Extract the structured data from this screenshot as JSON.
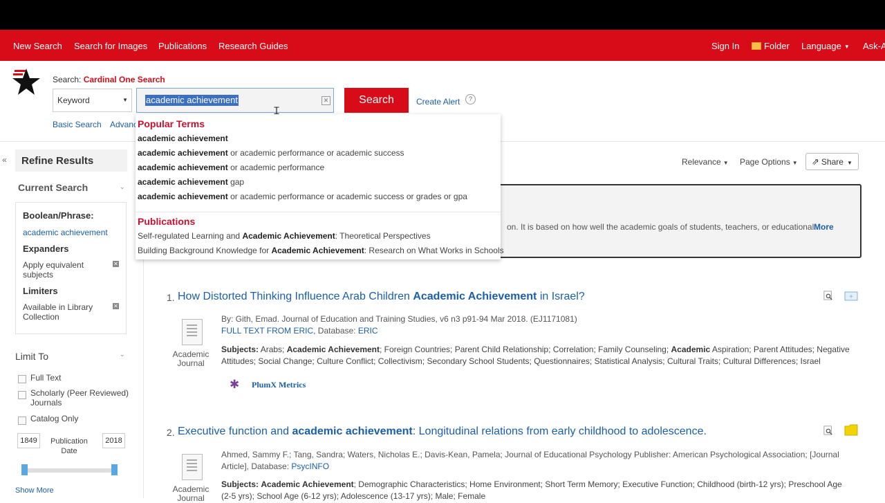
{
  "nav": {
    "new_search": "New Search",
    "search_images": "Search for Images",
    "publications": "Publications",
    "research_guides": "Research Guides",
    "sign_in": "Sign In",
    "folder": "Folder",
    "language": "Language",
    "ask": "Ask-A"
  },
  "search": {
    "label_prefix": "Search:",
    "label_db": "Cardinal One Search",
    "field_type": "Keyword",
    "query": "academic achievement",
    "button": "Search",
    "create_alert": "Create Alert",
    "help": "?",
    "basic": "Basic Search",
    "advanced": "Advanced Search"
  },
  "autocomplete": {
    "popular_heading": "Popular Terms",
    "terms": [
      {
        "bold": "academic achievement",
        "rest": ""
      },
      {
        "bold": "academic achievement",
        "rest": " or academic performance or academic success"
      },
      {
        "bold": "academic achievement",
        "rest": " or academic performance"
      },
      {
        "bold": "academic achievement",
        "rest": " gap"
      },
      {
        "bold": "academic achievement",
        "rest": " or academic performance or academic success or grades or gpa"
      }
    ],
    "publications_heading": "Publications",
    "publications": [
      {
        "pre": "Self-regulated Learning and ",
        "bold": "Academic Achievement",
        "post": ": Theoretical Perspectives"
      },
      {
        "pre": "Building Background Knowledge for ",
        "bold": "Academic Achievement",
        "post": ": Research on What Works in Schools"
      }
    ]
  },
  "sidebar": {
    "refine_title": "Refine Results",
    "current_search": "Current Search",
    "boolean_label": "Boolean/Phrase:",
    "boolean_value": "academic achievement",
    "expanders": "Expanders",
    "expander_item": "Apply equivalent subjects",
    "limiters": "Limiters",
    "limiter_item": "Available in Library Collection",
    "limit_to": "Limit To",
    "full_text": "Full Text",
    "scholarly": "Scholarly (Peer Reviewed) Journals",
    "catalog_only": "Catalog Only",
    "date_from": "1849",
    "date_label": "Publication Date",
    "date_to": "2018",
    "show_more": "Show More"
  },
  "toolbar": {
    "relevance": "Relevance",
    "page_options": "Page Options",
    "share": "Share"
  },
  "research_starter": {
    "text": "on. It is based on how well the academic goals of students, teachers, or educational...",
    "more": "More"
  },
  "results": [
    {
      "num": "1.",
      "title_pre": "How Distorted Thinking Influence Arab Children ",
      "title_bold": "Academic Achievement",
      "title_post": " in Israel?",
      "type": "Academic Journal",
      "byline": "By: Gith, Emad. Journal of Education and Training Studies, v6 n3 p91-94 Mar 2018. (EJ1171081)",
      "fulltext": "FULL TEXT FROM ERIC",
      "db_sep": ", Database: ",
      "database": "ERIC",
      "subjects_label": "Subjects:",
      "subjects_html": "Arabs; <b>Academic Achievement</b>; Foreign Countries; Parent Child Relationship; Correlation; Family Counseling; <b>Academic</b> Aspiration; Parent Attitudes; Negative Attitudes; Social Change; Culture Conflict; Collectivism; Secondary School Students; Questionnaires; Statistical Analysis; Cultural Traits; Cultural Differences; Israel",
      "plumx": "PlumX Metrics"
    },
    {
      "num": "2.",
      "title_pre": "Executive function and ",
      "title_bold": "academic achievement",
      "title_post": ": Longitudinal relations from early childhood to adolescence.",
      "type": "Academic Journal",
      "byline": "Ahmed, Sammy F.; Tang, Sandra; Waters, Nicholas E.; Davis-Kean, Pamela; Journal of Educational Psychology Publisher: American Psychological Association; [Journal Article], Database: ",
      "database": "PsycINFO",
      "subjects_label": "Subjects:",
      "subjects_html": "<b>Academic Achievement</b>; Demographic Characteristics; Home Environment; Short Term Memory; Executive Function; Childhood (birth-12 yrs); Preschool Age (2-5 yrs); School Age (6-12 yrs); Adolescence (13-17 yrs); Male; Female"
    }
  ]
}
